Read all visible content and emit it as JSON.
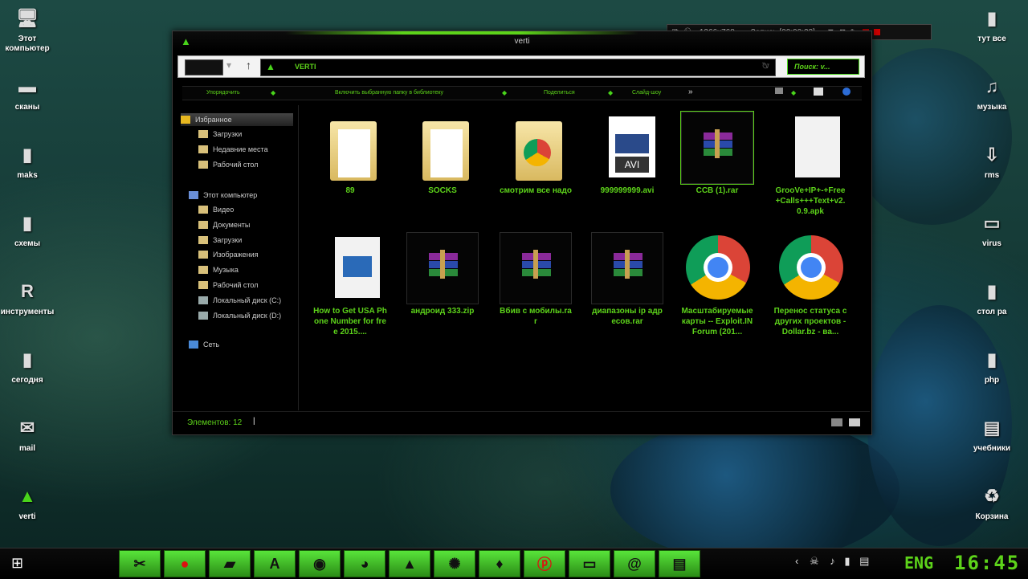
{
  "desktop_left": [
    {
      "label": "Этот компьютер",
      "icon": "computer-icon"
    },
    {
      "label": "сканы",
      "icon": "scanner-icon"
    },
    {
      "label": "maks",
      "icon": "folder-icon"
    },
    {
      "label": "схемы",
      "icon": "folder-icon"
    },
    {
      "label": "инструменты",
      "icon": "tools-icon"
    },
    {
      "label": "сегодня",
      "icon": "folder-icon"
    },
    {
      "label": "mail",
      "icon": "mail-icon"
    },
    {
      "label": "verti",
      "icon": "verti-icon"
    }
  ],
  "desktop_right": [
    {
      "label": "тут все",
      "icon": "folder-icon"
    },
    {
      "label": "музыка",
      "icon": "music-icon"
    },
    {
      "label": "rms",
      "icon": "download-icon"
    },
    {
      "label": "virus",
      "icon": "drive-icon"
    },
    {
      "label": "стол ра",
      "icon": "folder-icon"
    },
    {
      "label": "php",
      "icon": "folder-icon"
    },
    {
      "label": "учебники",
      "icon": "books-icon"
    },
    {
      "label": "Корзина",
      "icon": "recycle-bin-icon"
    }
  ],
  "recorder": {
    "resolution": "1366x768",
    "record_label": "Запись [00:00:22]"
  },
  "window": {
    "title": "verti",
    "path": "VERTI",
    "search_placeholder": "Поиск: v...",
    "commands": [
      "Упорядочить",
      "Включить выбранную папку в библиотеку",
      "Поделиться",
      "Слайд-шоу",
      "»"
    ],
    "nav": {
      "favorites": "Избранное",
      "fav_items": [
        "Загрузки",
        "Недавние места",
        "Рабочий стол"
      ],
      "computer": "Этот компьютер",
      "comp_items": [
        "Видео",
        "Документы",
        "Загрузки",
        "Изображения",
        "Музыка",
        "Рабочий стол",
        "Локальный диск (C:)",
        "Локальный диск (D:)"
      ],
      "network": "Сеть"
    },
    "files": [
      {
        "name": "89",
        "type": "folder"
      },
      {
        "name": "SOCKS",
        "type": "folder"
      },
      {
        "name": "смотрим все надо",
        "type": "folder-chrome"
      },
      {
        "name": "999999999.avi",
        "type": "avi",
        "badge": "AVI"
      },
      {
        "name": "CCB (1).rar",
        "type": "rar",
        "selected": true
      },
      {
        "name": "GrooVe+IP+-+Free+Calls+++Text+v2.0.9.apk",
        "type": "blank"
      },
      {
        "name": "How to Get USA Phone Number for free 2015....",
        "type": "video"
      },
      {
        "name": "андроид 333.zip",
        "type": "rar"
      },
      {
        "name": "Вбив с мобилы.rar",
        "type": "rar"
      },
      {
        "name": "диапазоны ip адресов.rar",
        "type": "rar"
      },
      {
        "name": "Масштабируемые карты -- Exploit.IN Forum (201...",
        "type": "chrome"
      },
      {
        "name": "Перенос статуса с других проектов - Dollar.bz - ва...",
        "type": "chrome"
      }
    ],
    "status": "Элементов: 12"
  },
  "taskbar": {
    "items": [
      "snipping-tool",
      "record",
      "notes",
      "font",
      "wifi",
      "chrome",
      "vlc",
      "pineapple",
      "python",
      "pinterest",
      "cmd",
      "mail",
      "explorer"
    ],
    "lang": "ENG",
    "time": "16:45"
  }
}
